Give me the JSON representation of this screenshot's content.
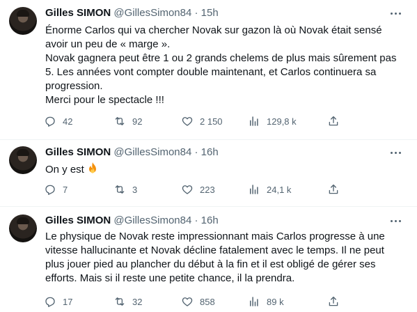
{
  "tweets": [
    {
      "author_name": "Gilles SIMON",
      "handle": "@GillesSimon84",
      "separator": "·",
      "time": "15h",
      "lines": [
        "Énorme Carlos qui va chercher Novak sur gazon là où Novak était sensé",
        "avoir un peu de « marge ».",
        "Novak gagnera peut être 1 ou 2 grands chelems de plus mais sûrement pas",
        "5. Les années vont compter double maintenant, et Carlos continuera sa",
        "progression.",
        "Merci pour le spectacle !!!"
      ],
      "replies": "42",
      "retweets": "92",
      "likes": "2 150",
      "views": "129,8 k"
    },
    {
      "author_name": "Gilles SIMON",
      "handle": "@GillesSimon84",
      "separator": "·",
      "time": "16h",
      "text": "On y est",
      "emoji_icon": "fire-emoji",
      "replies": "7",
      "retweets": "3",
      "likes": "223",
      "views": "24,1 k"
    },
    {
      "author_name": "Gilles SIMON",
      "handle": "@GillesSimon84",
      "separator": "·",
      "time": "16h",
      "lines": [
        "Le physique de Novak reste impressionnant mais Carlos progresse à une",
        "vitesse hallucinante et Novak décline fatalement avec le temps. Il ne peut",
        "plus jouer pied au plancher du début à la fin et il est obligé de gérer ses",
        "efforts. Mais si il reste une petite chance, il la prendra."
      ],
      "replies": "17",
      "retweets": "32",
      "likes": "858",
      "views": "89 k"
    }
  ],
  "icons": [
    "reply-icon",
    "retweet-icon",
    "like-icon",
    "views-icon",
    "share-icon",
    "more-icon"
  ],
  "colors": {
    "text": "#0f1419",
    "secondary": "#536471",
    "divider": "#eff3f4"
  }
}
